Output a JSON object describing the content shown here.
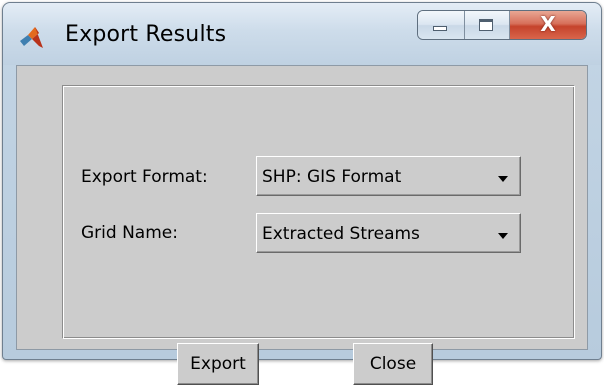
{
  "window": {
    "title": "Export Results",
    "controls": {
      "close_glyph": "X"
    }
  },
  "form": {
    "export_format": {
      "label": "Export Format:",
      "value": "SHP: GIS Format"
    },
    "grid_name": {
      "label": "Grid Name:",
      "value": "Extracted Streams"
    }
  },
  "buttons": {
    "export_label": "Export",
    "close_label": "Close"
  },
  "icons": {
    "app": "matlab-icon",
    "minimize": "minimize-icon",
    "maximize": "maximize-icon",
    "close": "close-icon",
    "dropdown": "chevron-down-icon"
  },
  "colors": {
    "client_bg": "#cccccc",
    "close_button": "#c5432c",
    "title_frame": "#c2d4e4"
  }
}
